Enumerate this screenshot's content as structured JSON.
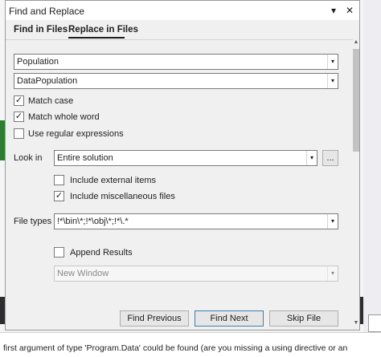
{
  "dialog": {
    "title": "Find and Replace",
    "title_dropdown_glyph": "▾",
    "close_glyph": "✕"
  },
  "tabs": [
    {
      "label": "Find in Files"
    },
    {
      "label": "Replace in Files"
    }
  ],
  "find": {
    "value": "Population"
  },
  "replace": {
    "value": "DataPopulation"
  },
  "options": {
    "match_case": {
      "label": "Match case",
      "checked": true
    },
    "match_whole_word": {
      "label": "Match whole word",
      "checked": true
    },
    "use_regex": {
      "label": "Use regular expressions",
      "checked": false
    }
  },
  "look_in": {
    "label": "Look in",
    "value": "Entire solution",
    "browse_label": "..."
  },
  "include": {
    "external": {
      "label": "Include external items",
      "checked": false
    },
    "misc": {
      "label": "Include miscellaneous files",
      "checked": true
    }
  },
  "file_types": {
    "label": "File types",
    "value": "!*\\bin\\*;!*\\obj\\*;!*\\.*"
  },
  "append_results": {
    "label": "Append Results",
    "checked": false
  },
  "result_window": {
    "value": "New Window"
  },
  "buttons": {
    "find_previous": "Find Previous",
    "find_next": "Find Next",
    "skip_file": "Skip File"
  },
  "background": {
    "status_text": "first argument of type 'Program.Data' could be found (are you missing a using directive or an"
  },
  "glyphs": {
    "dropdown": "▾",
    "check": "✓",
    "scroll_up": "▲",
    "scroll_down": "▼"
  }
}
